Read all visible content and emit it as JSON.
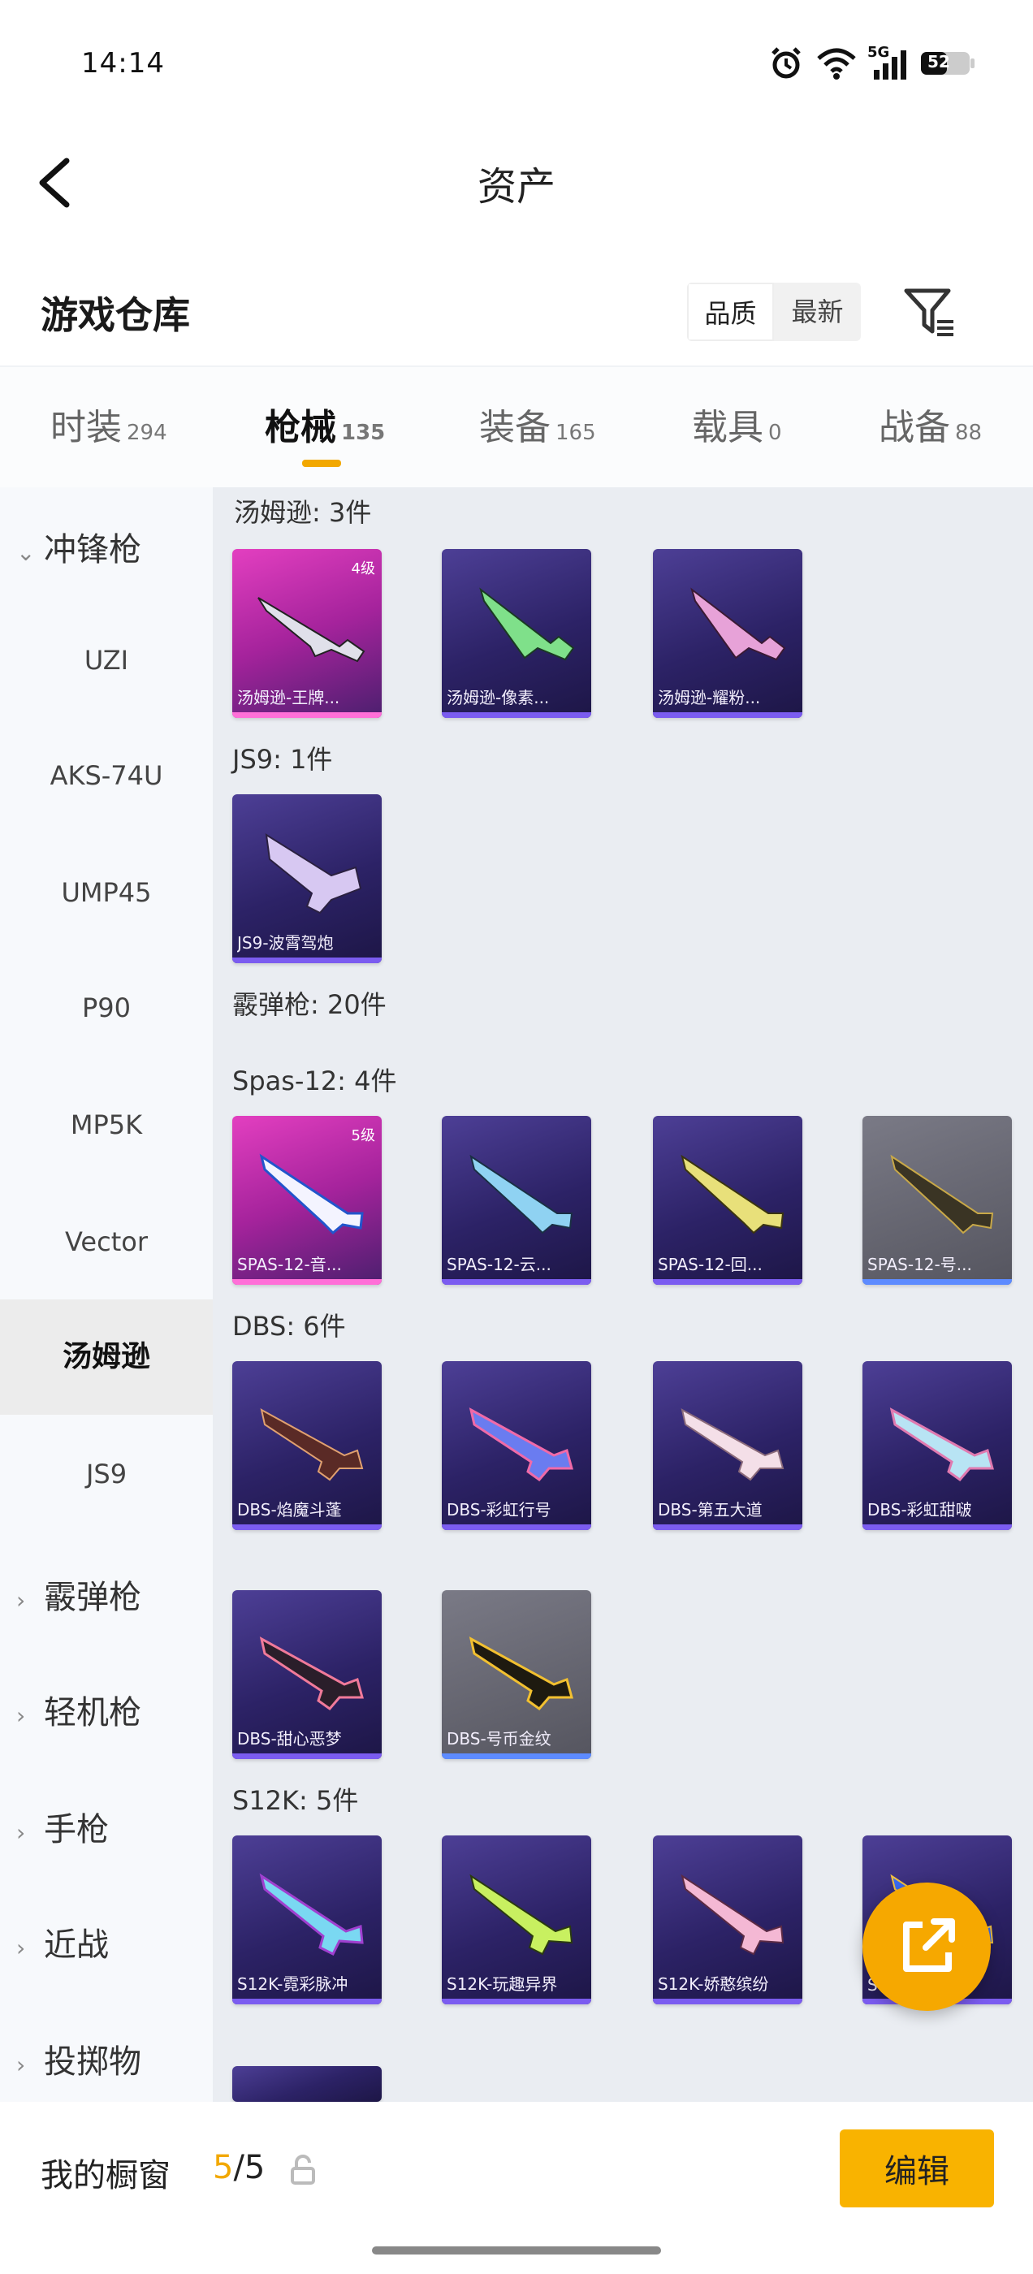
{
  "status": {
    "time": "14:14",
    "network": "5G",
    "battery": "52"
  },
  "header": {
    "title": "资产"
  },
  "warehouse": {
    "title": "游戏仓库",
    "sort": [
      "品质",
      "最新"
    ]
  },
  "tabs": [
    {
      "label": "时装",
      "count": "294"
    },
    {
      "label": "枪械",
      "count": "135"
    },
    {
      "label": "装备",
      "count": "165"
    },
    {
      "label": "载具",
      "count": "0"
    },
    {
      "label": "战备",
      "count": "88"
    }
  ],
  "sidebar": {
    "group_open": "冲锋枪",
    "items": [
      "UZI",
      "AKS-74U",
      "UMP45",
      "P90",
      "MP5K",
      "Vector",
      "汤姆逊",
      "JS9"
    ],
    "groups": [
      "霰弹枪",
      "轻机枪",
      "手枪",
      "近战",
      "投掷物"
    ]
  },
  "sections": {
    "thompson": {
      "label": "汤姆逊: 3件",
      "cards": [
        {
          "name": "汤姆逊-王牌...",
          "level": "4级"
        },
        {
          "name": "汤姆逊-像素..."
        },
        {
          "name": "汤姆逊-耀粉..."
        }
      ]
    },
    "js9": {
      "label": "JS9: 1件",
      "cards": [
        {
          "name": "JS9-波霄驾炮"
        }
      ]
    },
    "shotgun": {
      "label": "霰弹枪: 20件"
    },
    "spas": {
      "label": "Spas-12: 4件",
      "cards": [
        {
          "name": "SPAS-12-音...",
          "level": "5级"
        },
        {
          "name": "SPAS-12-云..."
        },
        {
          "name": "SPAS-12-回..."
        },
        {
          "name": "SPAS-12-号..."
        }
      ]
    },
    "dbs": {
      "label": "DBS: 6件",
      "cards": [
        {
          "name": "DBS-焰魔斗蓬"
        },
        {
          "name": "DBS-彩虹行号"
        },
        {
          "name": "DBS-第五大道"
        },
        {
          "name": "DBS-彩虹甜啵"
        },
        {
          "name": "DBS-甜心恶梦"
        },
        {
          "name": "DBS-号币金纹"
        }
      ]
    },
    "s12k": {
      "label": "S12K: 5件",
      "cards": [
        {
          "name": "S12K-霓彩脉冲"
        },
        {
          "name": "S12K-玩趣异界"
        },
        {
          "name": "S12K-娇憨缤纷"
        },
        {
          "name": "S12K-..."
        }
      ]
    }
  },
  "bottom": {
    "showcase_label": "我的橱窗",
    "count_current": "5",
    "count_total": "/5",
    "edit_label": "编辑"
  }
}
